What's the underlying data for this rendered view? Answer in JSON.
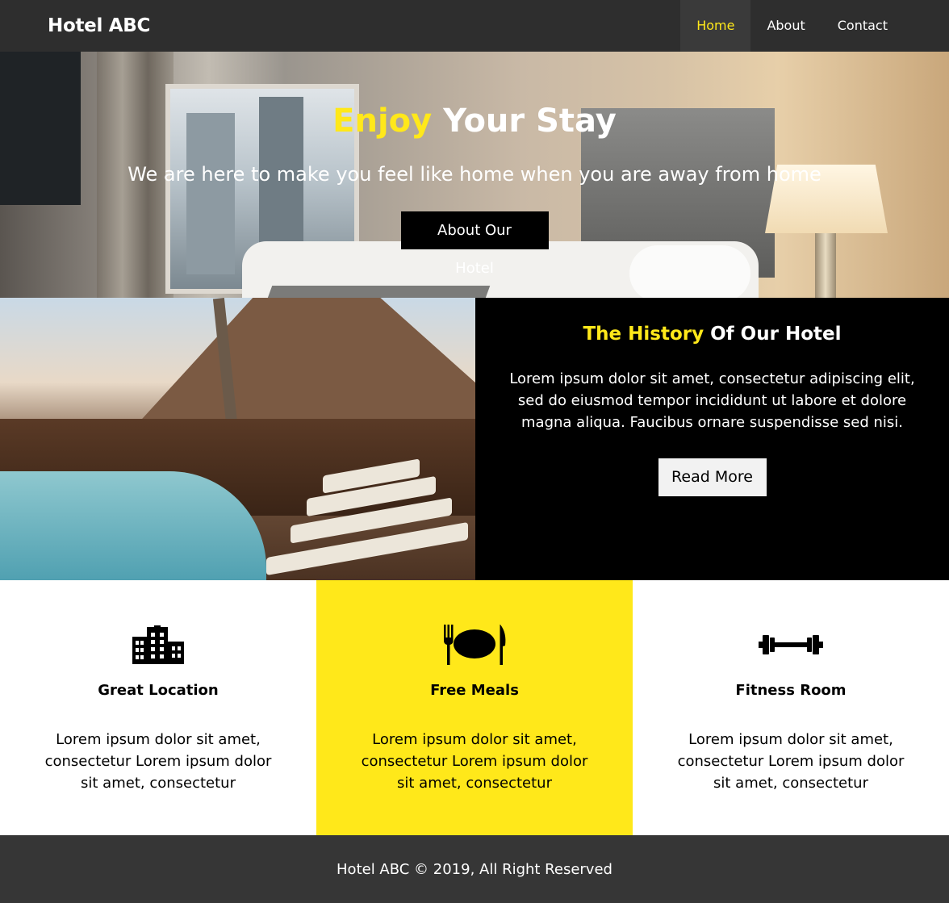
{
  "nav": {
    "brand": "Hotel ABC",
    "items": [
      {
        "label": "Home",
        "active": true
      },
      {
        "label": "About",
        "active": false
      },
      {
        "label": "Contact",
        "active": false
      }
    ]
  },
  "hero": {
    "title_accent": "Enjoy",
    "title_rest": " Your Stay",
    "subtitle": "We are here to make you feel like home when you are away from home",
    "button_label": "About Our Hotel",
    "background_image": "hotel-bedroom-photo"
  },
  "history": {
    "title_accent": "The History",
    "title_rest": " Of Our Hotel",
    "text": "Lorem ipsum dolor sit amet, consectetur adipiscing elit, sed do eiusmod tempor incididunt ut labore et dolore magna aliqua. Faucibus ornare suspendisse sed nisi.",
    "button_label": "Read More",
    "image": "poolside-lodge-photo"
  },
  "features": [
    {
      "icon": "building-icon",
      "title": "Great Location",
      "text": "Lorem ipsum dolor sit amet, consectetur Lorem ipsum dolor sit amet, consectetur"
    },
    {
      "icon": "utensils-icon",
      "title": "Free Meals",
      "text": "Lorem ipsum dolor sit amet, consectetur Lorem ipsum dolor sit amet, consectetur"
    },
    {
      "icon": "dumbbell-icon",
      "title": "Fitness Room",
      "text": "Lorem ipsum dolor sit amet, consectetur Lorem ipsum dolor sit amet, consectetur"
    }
  ],
  "footer": {
    "text": "Hotel ABC © 2019, All Right Reserved"
  },
  "colors": {
    "accent": "#ffe81a",
    "nav_bg": "#2e2e2e",
    "footer_bg": "#363636",
    "history_bg": "#000000"
  }
}
